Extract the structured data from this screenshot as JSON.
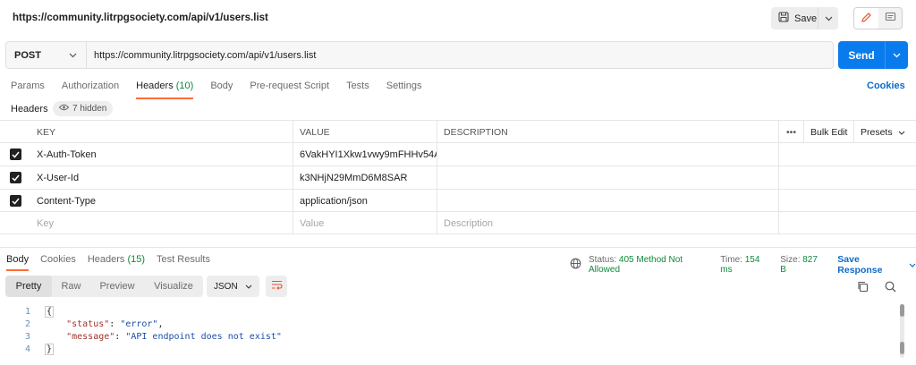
{
  "title": "https://community.litrpgsociety.com/api/v1/users.list",
  "toolbar": {
    "save_label": "Save"
  },
  "request": {
    "method": "POST",
    "url": "https://community.litrpgsociety.com/api/v1/users.list",
    "send_label": "Send"
  },
  "req_tabs": [
    {
      "label": "Params"
    },
    {
      "label": "Authorization"
    },
    {
      "label": "Headers",
      "count": "(10)"
    },
    {
      "label": "Body"
    },
    {
      "label": "Pre-request Script"
    },
    {
      "label": "Tests"
    },
    {
      "label": "Settings"
    }
  ],
  "cookies_label": "Cookies",
  "headers_section": {
    "label": "Headers",
    "hidden": "7 hidden"
  },
  "table": {
    "columns": {
      "key": "KEY",
      "value": "VALUE",
      "description": "DESCRIPTION",
      "more": "•••",
      "bulk_edit": "Bulk Edit",
      "presets": "Presets"
    },
    "rows": [
      {
        "key": "X-Auth-Token",
        "value": "6VakHYI1Xkw1vwy9mFHHv54A...",
        "description": ""
      },
      {
        "key": "X-User-Id",
        "value": "k3NHjN29MmD6M8SAR",
        "description": ""
      },
      {
        "key": "Content-Type",
        "value": "application/json",
        "description": ""
      }
    ],
    "placeholders": {
      "key": "Key",
      "value": "Value",
      "description": "Description"
    }
  },
  "response": {
    "tabs": [
      {
        "label": "Body"
      },
      {
        "label": "Cookies"
      },
      {
        "label": "Headers",
        "count": "(15)"
      },
      {
        "label": "Test Results"
      }
    ],
    "status_label": "Status:",
    "status_value": "405 Method Not Allowed",
    "time_label": "Time:",
    "time_value": "154 ms",
    "size_label": "Size:",
    "size_value": "827 B",
    "save_response": "Save Response",
    "view_modes": [
      "Pretty",
      "Raw",
      "Preview",
      "Visualize"
    ],
    "format": "JSON",
    "code": {
      "line_numbers": [
        "1",
        "2",
        "3",
        "4"
      ],
      "open": "{",
      "close": "}",
      "status_key": "\"status\"",
      "status_val": "\"error\"",
      "message_key": "\"message\"",
      "message_val": "\"API endpoint does not exist\""
    }
  },
  "colors": {
    "accent": "#ff6c37",
    "send": "#097bed",
    "link": "#0b6bcb",
    "success": "#0c8a3a"
  }
}
